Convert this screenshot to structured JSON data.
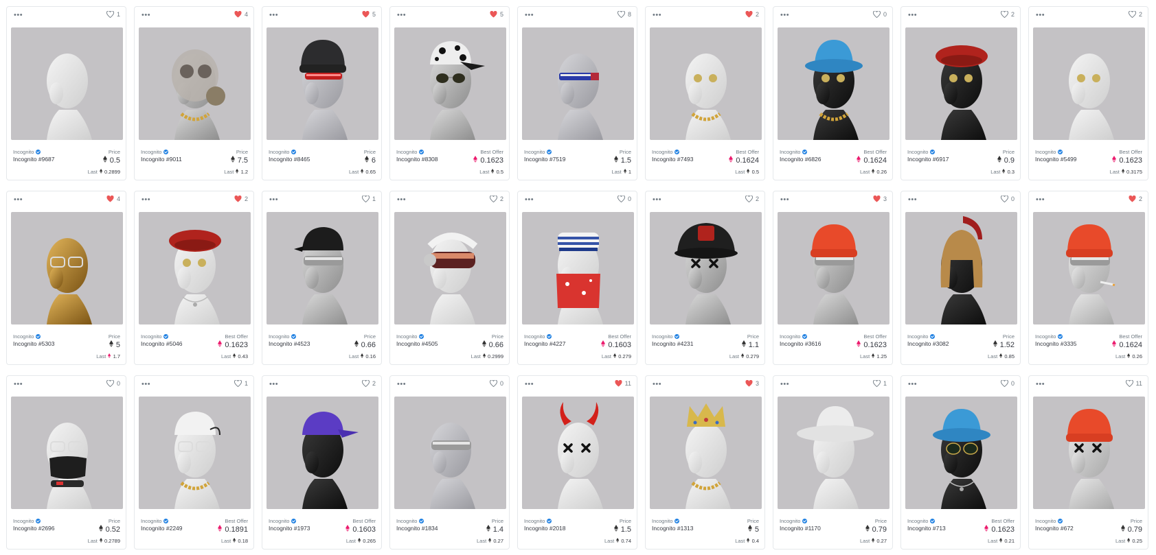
{
  "colors": {
    "eth_black": "#343434",
    "weth_pink": "#ec1c6e",
    "heart_red": "#eb5757",
    "heart_outline": "#707a83",
    "thumb_bg": "#c4c2c5",
    "verified_blue": "#2081e2"
  },
  "more_label": "•••",
  "last_label": "Last",
  "items": [
    {
      "collection": "Incognito",
      "name": "Incognito #9687",
      "likes": "1",
      "liked": false,
      "price_label": "Price",
      "currency": "eth",
      "price": "0.5",
      "last_currency": "eth",
      "last": "0.2899",
      "head": "white",
      "hat": "none",
      "eyes": "none",
      "extra": "none"
    },
    {
      "collection": "Incognito",
      "name": "Incognito #9011",
      "likes": "4",
      "liked": true,
      "price_label": "Price",
      "currency": "eth",
      "price": "7.5",
      "last_currency": "eth",
      "last": "1.2",
      "head": "chrome",
      "hat": "gasmask",
      "eyes": "none",
      "extra": "chain"
    },
    {
      "collection": "Incognito",
      "name": "Incognito #8465",
      "likes": "5",
      "liked": true,
      "price_label": "Price",
      "currency": "eth",
      "price": "6",
      "last_currency": "eth",
      "last": "0.65",
      "head": "glass",
      "hat": "beanie-black",
      "eyes": "visor-red",
      "extra": "none"
    },
    {
      "collection": "Incognito",
      "name": "Incognito #8308",
      "likes": "5",
      "liked": true,
      "price_label": "Best Offer",
      "currency": "weth",
      "price": "0.1623",
      "last_currency": "eth",
      "last": "0.5",
      "head": "chrome",
      "hat": "cap-camo",
      "eyes": "sunglasses",
      "extra": "none"
    },
    {
      "collection": "Incognito",
      "name": "Incognito #7519",
      "likes": "8",
      "liked": false,
      "price_label": "Price",
      "currency": "eth",
      "price": "1.5",
      "last_currency": "eth",
      "last": "1",
      "head": "glass",
      "hat": "none",
      "eyes": "visor-blue",
      "extra": "none"
    },
    {
      "collection": "Incognito",
      "name": "Incognito #7493",
      "likes": "2",
      "liked": true,
      "price_label": "Best Offer",
      "currency": "weth",
      "price": "0.1624",
      "last_currency": "eth",
      "last": "0.5",
      "head": "white",
      "hat": "none",
      "eyes": "coins",
      "extra": "chain"
    },
    {
      "collection": "Incognito",
      "name": "Incognito #6826",
      "likes": "0",
      "liked": false,
      "price_label": "Best Offer",
      "currency": "weth",
      "price": "0.1624",
      "last_currency": "eth",
      "last": "0.26",
      "head": "black",
      "hat": "bucket-blue",
      "eyes": "coins",
      "extra": "chain"
    },
    {
      "collection": "Incognito",
      "name": "Incognito #6917",
      "likes": "2",
      "liked": false,
      "price_label": "Price",
      "currency": "eth",
      "price": "0.9",
      "last_currency": "eth",
      "last": "0.3",
      "head": "black",
      "hat": "beret-red",
      "eyes": "coins",
      "extra": "none"
    },
    {
      "collection": "Incognito",
      "name": "Incognito #5499",
      "likes": "2",
      "liked": false,
      "price_label": "Best Offer",
      "currency": "weth",
      "price": "0.1623",
      "last_currency": "eth",
      "last": "0.3175",
      "head": "white",
      "hat": "none",
      "eyes": "coins",
      "extra": "none"
    },
    {
      "collection": "Incognito",
      "name": "Incognito #5303",
      "likes": "4",
      "liked": true,
      "price_label": "Price",
      "currency": "eth",
      "price": "5",
      "last_currency": "weth",
      "last": "1.7",
      "head": "gold",
      "hat": "none",
      "eyes": "glasses-clear",
      "extra": "none"
    },
    {
      "collection": "Incognito",
      "name": "Incognito #5046",
      "likes": "2",
      "liked": true,
      "price_label": "Best Offer",
      "currency": "weth",
      "price": "0.1623",
      "last_currency": "eth",
      "last": "0.43",
      "head": "white",
      "hat": "beret-red",
      "eyes": "coins",
      "extra": "pendant"
    },
    {
      "collection": "Incognito",
      "name": "Incognito #4523",
      "likes": "1",
      "liked": false,
      "price_label": "Price",
      "currency": "eth",
      "price": "0.66",
      "last_currency": "eth",
      "last": "0.16",
      "head": "chrome",
      "hat": "cap-back-black",
      "eyes": "visor-silver",
      "extra": "none"
    },
    {
      "collection": "Incognito",
      "name": "Incognito #4505",
      "likes": "2",
      "liked": false,
      "price_label": "Price",
      "currency": "eth",
      "price": "0.66",
      "last_currency": "eth",
      "last": "0.2999",
      "head": "white",
      "hat": "ski-goggles",
      "eyes": "none",
      "extra": "none"
    },
    {
      "collection": "Incognito",
      "name": "Incognito #4227",
      "likes": "0",
      "liked": false,
      "price_label": "Best Offer",
      "currency": "weth",
      "price": "0.1603",
      "last_currency": "eth",
      "last": "0.279",
      "head": "white",
      "hat": "sailor",
      "eyes": "none",
      "extra": "bandana"
    },
    {
      "collection": "Incognito",
      "name": "Incognito #4231",
      "likes": "2",
      "liked": false,
      "price_label": "Price",
      "currency": "eth",
      "price": "1.1",
      "last_currency": "eth",
      "last": "0.279",
      "head": "chrome",
      "hat": "fireman",
      "eyes": "x-eyes",
      "extra": "none"
    },
    {
      "collection": "Incognito",
      "name": "Incognito #3616",
      "likes": "3",
      "liked": true,
      "price_label": "Best Offer",
      "currency": "weth",
      "price": "0.1623",
      "last_currency": "eth",
      "last": "1.25",
      "head": "chrome",
      "hat": "beanie-red",
      "eyes": "visor-silver",
      "extra": "none"
    },
    {
      "collection": "Incognito",
      "name": "Incognito #3082",
      "likes": "0",
      "liked": false,
      "price_label": "Price",
      "currency": "eth",
      "price": "1.52",
      "last_currency": "eth",
      "last": "0.85",
      "head": "black",
      "hat": "spartan",
      "eyes": "none",
      "extra": "none"
    },
    {
      "collection": "Incognito",
      "name": "Incognito #3335",
      "likes": "2",
      "liked": true,
      "price_label": "Best Offer",
      "currency": "weth",
      "price": "0.1624",
      "last_currency": "eth",
      "last": "0.26",
      "head": "marble",
      "hat": "beanie-red",
      "eyes": "visor-silver",
      "extra": "cigarette"
    },
    {
      "collection": "Incognito",
      "name": "Incognito #2696",
      "likes": "0",
      "liked": false,
      "price_label": "Price",
      "currency": "eth",
      "price": "0.52",
      "last_currency": "eth",
      "last": "0.2789",
      "head": "white",
      "hat": "none",
      "eyes": "glasses-clear",
      "extra": "mask-black"
    },
    {
      "collection": "Incognito",
      "name": "Incognito #2249",
      "likes": "1",
      "liked": false,
      "price_label": "Best Offer",
      "currency": "weth",
      "price": "0.1891",
      "last_currency": "eth",
      "last": "0.18",
      "head": "white",
      "hat": "cap-back-white",
      "eyes": "glasses-clear",
      "extra": "chain"
    },
    {
      "collection": "Incognito",
      "name": "Incognito #1973",
      "likes": "2",
      "liked": false,
      "price_label": "Best Offer",
      "currency": "weth",
      "price": "0.1603",
      "last_currency": "eth",
      "last": "0.265",
      "head": "black",
      "hat": "cap-purple",
      "eyes": "none",
      "extra": "none"
    },
    {
      "collection": "Incognito",
      "name": "Incognito #1834",
      "likes": "0",
      "liked": false,
      "price_label": "Price",
      "currency": "eth",
      "price": "1.4",
      "last_currency": "eth",
      "last": "0.27",
      "head": "glass",
      "hat": "none",
      "eyes": "visor-silver",
      "extra": "none"
    },
    {
      "collection": "Incognito",
      "name": "Incognito #2018",
      "likes": "11",
      "liked": true,
      "price_label": "Price",
      "currency": "eth",
      "price": "1.5",
      "last_currency": "eth",
      "last": "0.74",
      "head": "white",
      "hat": "devil-horns",
      "eyes": "x-eyes",
      "extra": "none"
    },
    {
      "collection": "Incognito",
      "name": "Incognito #1313",
      "likes": "3",
      "liked": true,
      "price_label": "Price",
      "currency": "eth",
      "price": "5",
      "last_currency": "eth",
      "last": "0.4",
      "head": "white",
      "hat": "crown",
      "eyes": "none",
      "extra": "chain"
    },
    {
      "collection": "Incognito",
      "name": "Incognito #1170",
      "likes": "1",
      "liked": false,
      "price_label": "Price",
      "currency": "eth",
      "price": "0.79",
      "last_currency": "eth",
      "last": "0.27",
      "head": "white",
      "hat": "cowboy-white",
      "eyes": "none",
      "extra": "none"
    },
    {
      "collection": "Incognito",
      "name": "Incognito #713",
      "likes": "0",
      "liked": false,
      "price_label": "Best Offer",
      "currency": "weth",
      "price": "0.1623",
      "last_currency": "eth",
      "last": "0.21",
      "head": "black",
      "hat": "bucket-blue",
      "eyes": "aviators",
      "extra": "pendant"
    },
    {
      "collection": "Incognito",
      "name": "Incognito #672",
      "likes": "11",
      "liked": false,
      "price_label": "Price",
      "currency": "eth",
      "price": "0.79",
      "last_currency": "eth",
      "last": "0.25",
      "head": "marble",
      "hat": "beanie-red",
      "eyes": "x-eyes",
      "extra": "none"
    }
  ]
}
